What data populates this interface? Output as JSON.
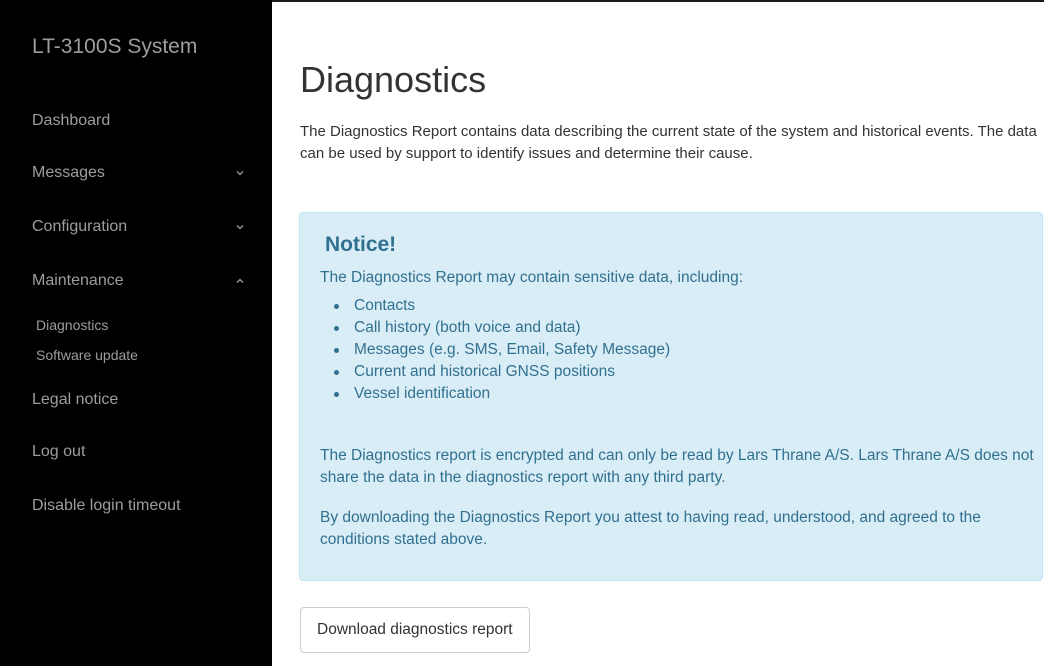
{
  "sidebar": {
    "brand": "LT-3100S System",
    "items": [
      {
        "label": "Dashboard"
      },
      {
        "label": "Messages",
        "chevron": "chevron-down-icon"
      },
      {
        "label": "Configuration",
        "chevron": "chevron-down-icon"
      },
      {
        "label": "Maintenance",
        "chevron": "chevron-up-icon"
      },
      {
        "label": "Legal notice"
      },
      {
        "label": "Log out"
      },
      {
        "label": "Disable login timeout"
      }
    ],
    "maintenance_sub": [
      {
        "label": "Diagnostics"
      },
      {
        "label": "Software update"
      }
    ]
  },
  "main": {
    "title": "Diagnostics",
    "intro": "The Diagnostics Report contains data describing the current state of the system and historical events. The data can be used by support to identify issues and determine their cause.",
    "notice": {
      "title": "Notice!",
      "lead": "The Diagnostics Report may contain sensitive data, including:",
      "items": [
        "Contacts",
        "Call history (both voice and data)",
        "Messages (e.g. SMS, Email, Safety Message)",
        "Current and historical GNSS positions",
        "Vessel identification"
      ],
      "encrypted": "The Diagnostics report is encrypted and can only be read by Lars Thrane A/S. Lars Thrane A/S does not share the data in the diagnostics report with any third party.",
      "agreement": "By downloading the Diagnostics Report you attest to having read, understood, and agreed to the conditions stated above."
    },
    "download_label": "Download diagnostics report"
  },
  "colors": {
    "sidebar_bg": "#000000",
    "sidebar_text": "#9d9d9d",
    "notice_bg": "#d9edf7",
    "notice_text": "#31708f"
  }
}
